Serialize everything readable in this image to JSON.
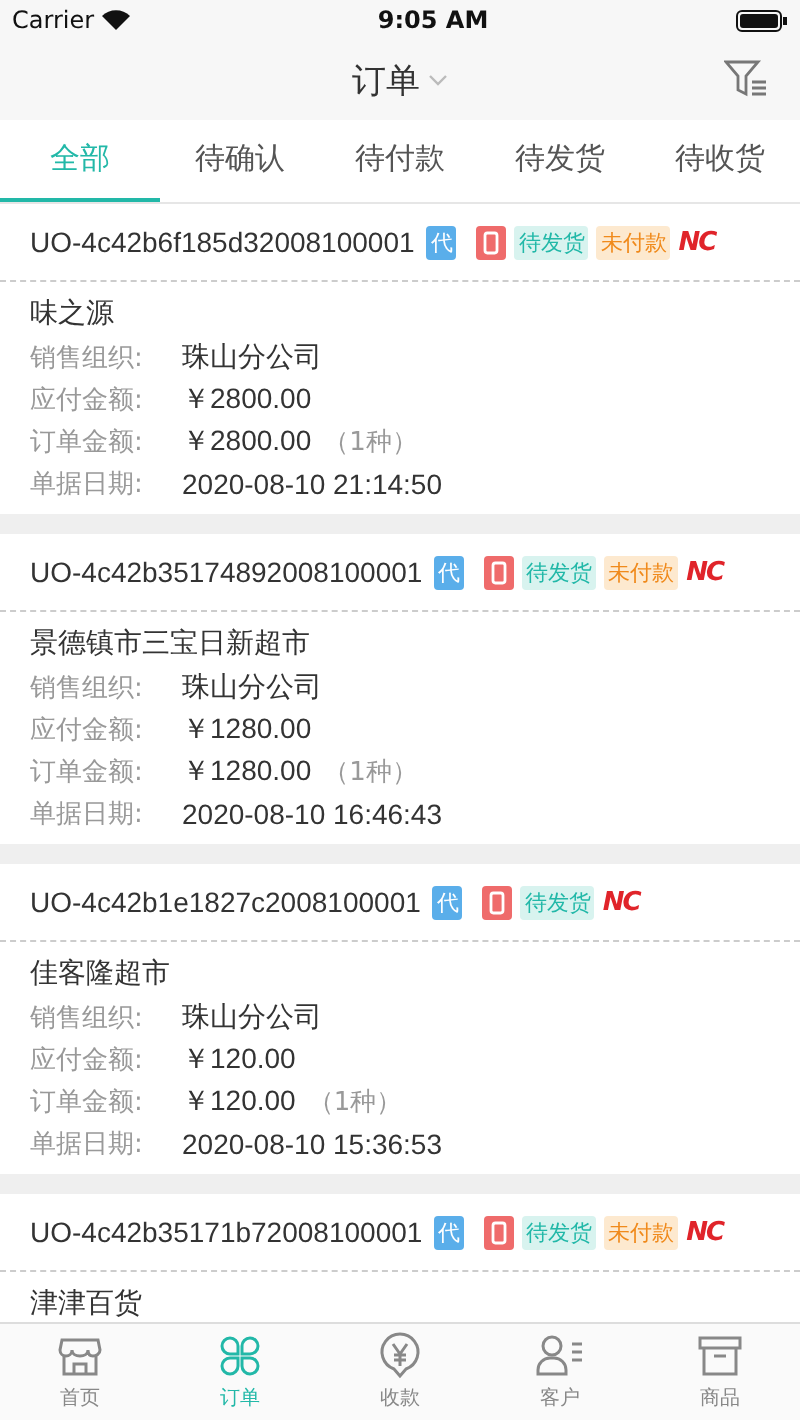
{
  "status_bar": {
    "carrier": "Carrier",
    "time": "9:05 AM"
  },
  "nav": {
    "title": "订单"
  },
  "tabs": [
    {
      "label": "全部",
      "selected": true
    },
    {
      "label": "待确认",
      "selected": false
    },
    {
      "label": "待付款",
      "selected": false
    },
    {
      "label": "待发货",
      "selected": false
    },
    {
      "label": "待收货",
      "selected": false
    }
  ],
  "orders": [
    {
      "number": "UO-4c42b6f185d32008100001",
      "tags": [
        {
          "kind": "agent",
          "text": "代"
        },
        {
          "kind": "phone"
        },
        {
          "kind": "ship",
          "text": "待发货"
        },
        {
          "kind": "pay",
          "text": "未付款"
        },
        {
          "kind": "logo",
          "text": "NC"
        }
      ],
      "customer": "味之源",
      "fields": [
        {
          "label": "销售组织:",
          "value": "珠山分公司"
        },
        {
          "label": "应付金额:",
          "value": "￥2800.00"
        },
        {
          "label": "订单金额:",
          "value": "￥2800.00",
          "note": "（1种）"
        },
        {
          "label": "单据日期:",
          "value": "2020-08-10 21:14:50"
        }
      ]
    },
    {
      "number": "UO-4c42b35174892008100001",
      "tags": [
        {
          "kind": "agent",
          "text": "代"
        },
        {
          "kind": "phone"
        },
        {
          "kind": "ship",
          "text": "待发货"
        },
        {
          "kind": "pay",
          "text": "未付款"
        },
        {
          "kind": "logo",
          "text": "NC"
        }
      ],
      "customer": "景德镇市三宝日新超市",
      "fields": [
        {
          "label": "销售组织:",
          "value": "珠山分公司"
        },
        {
          "label": "应付金额:",
          "value": "￥1280.00"
        },
        {
          "label": "订单金额:",
          "value": "￥1280.00",
          "note": "（1种）"
        },
        {
          "label": "单据日期:",
          "value": "2020-08-10 16:46:43"
        }
      ]
    },
    {
      "number": "UO-4c42b1e1827c2008100001",
      "tags": [
        {
          "kind": "agent",
          "text": "代"
        },
        {
          "kind": "phone"
        },
        {
          "kind": "ship",
          "text": "待发货"
        },
        {
          "kind": "logo",
          "text": "NC"
        }
      ],
      "customer": "佳客隆超市",
      "fields": [
        {
          "label": "销售组织:",
          "value": "珠山分公司"
        },
        {
          "label": "应付金额:",
          "value": "￥120.00"
        },
        {
          "label": "订单金额:",
          "value": "￥120.00",
          "note": "（1种）"
        },
        {
          "label": "单据日期:",
          "value": "2020-08-10 15:36:53"
        }
      ]
    },
    {
      "number": "UO-4c42b35171b72008100001",
      "tags": [
        {
          "kind": "agent",
          "text": "代"
        },
        {
          "kind": "phone"
        },
        {
          "kind": "ship",
          "text": "待发货"
        },
        {
          "kind": "pay",
          "text": "未付款"
        },
        {
          "kind": "logo",
          "text": "NC"
        }
      ],
      "customer": "津津百货"
    }
  ],
  "tab_bar": [
    {
      "kind": "store",
      "label": "首页",
      "selected": false
    },
    {
      "kind": "clover",
      "label": "订单",
      "selected": true
    },
    {
      "kind": "yen",
      "label": "收款",
      "selected": false
    },
    {
      "kind": "customer",
      "label": "客户",
      "selected": false
    },
    {
      "kind": "box",
      "label": "商品",
      "selected": false
    }
  ]
}
